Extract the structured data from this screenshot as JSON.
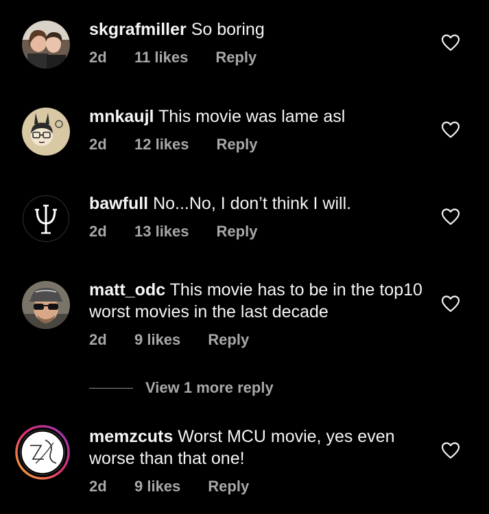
{
  "comments": [
    {
      "username": "skgrafmiller",
      "text": "So boring",
      "time": "2d",
      "likes": "11 likes",
      "reply": "Reply",
      "avatar": "couple-photo-avatar"
    },
    {
      "username": "mnkaujl",
      "text": "This movie was lame asl",
      "time": "2d",
      "likes": "12 likes",
      "reply": "Reply",
      "avatar": "cartoon-bunny-girl-avatar"
    },
    {
      "username": "bawfull",
      "text": "No...No, I don’t think I will.",
      "time": "2d",
      "likes": "13 likes",
      "reply": "Reply",
      "avatar": "psi-symbol-avatar"
    },
    {
      "username": "matt_odc",
      "text": "This movie has to be in the top10 worst movies in the last decade",
      "time": "2d",
      "likes": "9 likes",
      "reply": "Reply",
      "avatar": "man-sunglasses-cap-avatar"
    },
    {
      "username": "memzcuts",
      "text": "Worst MCU movie, yes even worse than that one!",
      "time": "2d",
      "likes": "9 likes",
      "reply": "Reply",
      "avatar": "logo-with-story-ring-avatar"
    }
  ],
  "view_more_replies": "View 1 more reply",
  "colors": {
    "background": "#000000",
    "primary_text": "#f5f5f5",
    "secondary_text": "#a8a8a8"
  }
}
